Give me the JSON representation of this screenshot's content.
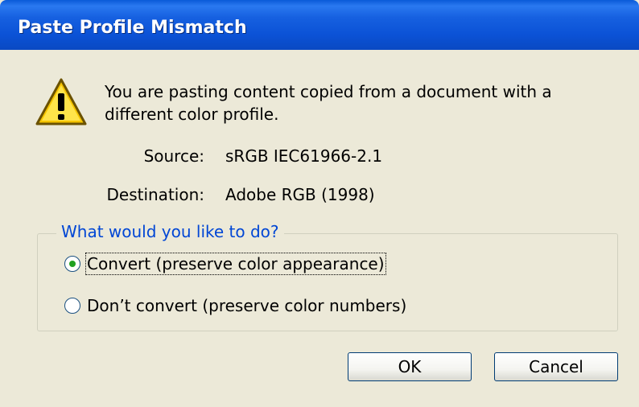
{
  "dialog": {
    "title": "Paste Profile Mismatch",
    "message": "You are pasting content copied from a document with a different color profile.",
    "source_label": "Source:",
    "source_value": "sRGB IEC61966-2.1",
    "destination_label": "Destination:",
    "destination_value": "Adobe RGB (1998)",
    "group_label": "What would you like to do?",
    "options": [
      {
        "label": "Convert (preserve color appearance)",
        "selected": true
      },
      {
        "label": "Don’t convert (preserve color numbers)",
        "selected": false
      }
    ],
    "ok_label": "OK",
    "cancel_label": "Cancel"
  },
  "colors": {
    "titlebar": "#0a5ad8",
    "dialog_bg": "#ece9d8",
    "group_label": "#0046d5",
    "radio_dot": "#21a121"
  },
  "icons": {
    "warning": "warning-icon"
  }
}
